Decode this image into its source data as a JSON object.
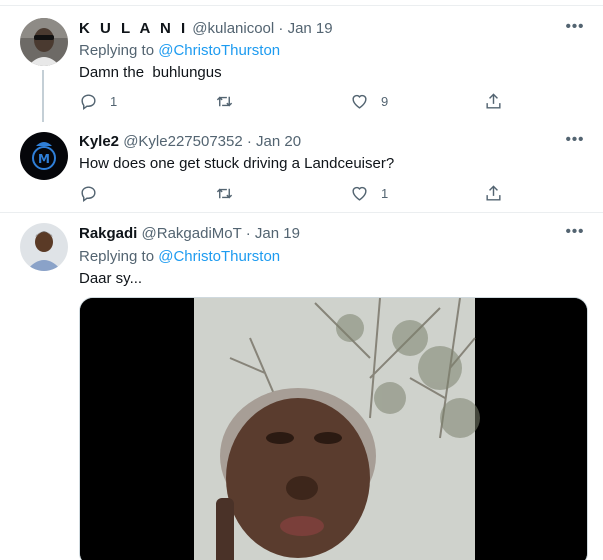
{
  "tweets": [
    {
      "name": "K U L A N I",
      "handle": "@kulanicool",
      "date": "Jan 19",
      "replying_label": "Replying to",
      "replying_to": "@ChristoThurston",
      "text": "Damn the  buhlungus",
      "replies": "1",
      "retweets": "",
      "likes": "9"
    },
    {
      "name": "Kyle2",
      "handle": "@Kyle227507352",
      "date": "Jan 20",
      "text": "How does one get stuck driving a Landceuiser?",
      "replies": "",
      "retweets": "",
      "likes": "1"
    },
    {
      "name": "Rakgadi",
      "handle": "@RakgadiMoT",
      "date": "Jan 19",
      "replying_label": "Replying to",
      "replying_to": "@ChristoThurston",
      "text": "Daar sy..."
    }
  ],
  "separator": " · ",
  "more_glyph": "•••",
  "colors": {
    "secondary_text": "#536471",
    "accent": "#1d9bf0",
    "divider": "#ebeef0"
  },
  "icons": [
    "reply-icon",
    "retweet-icon",
    "like-icon",
    "share-icon",
    "more-icon"
  ]
}
